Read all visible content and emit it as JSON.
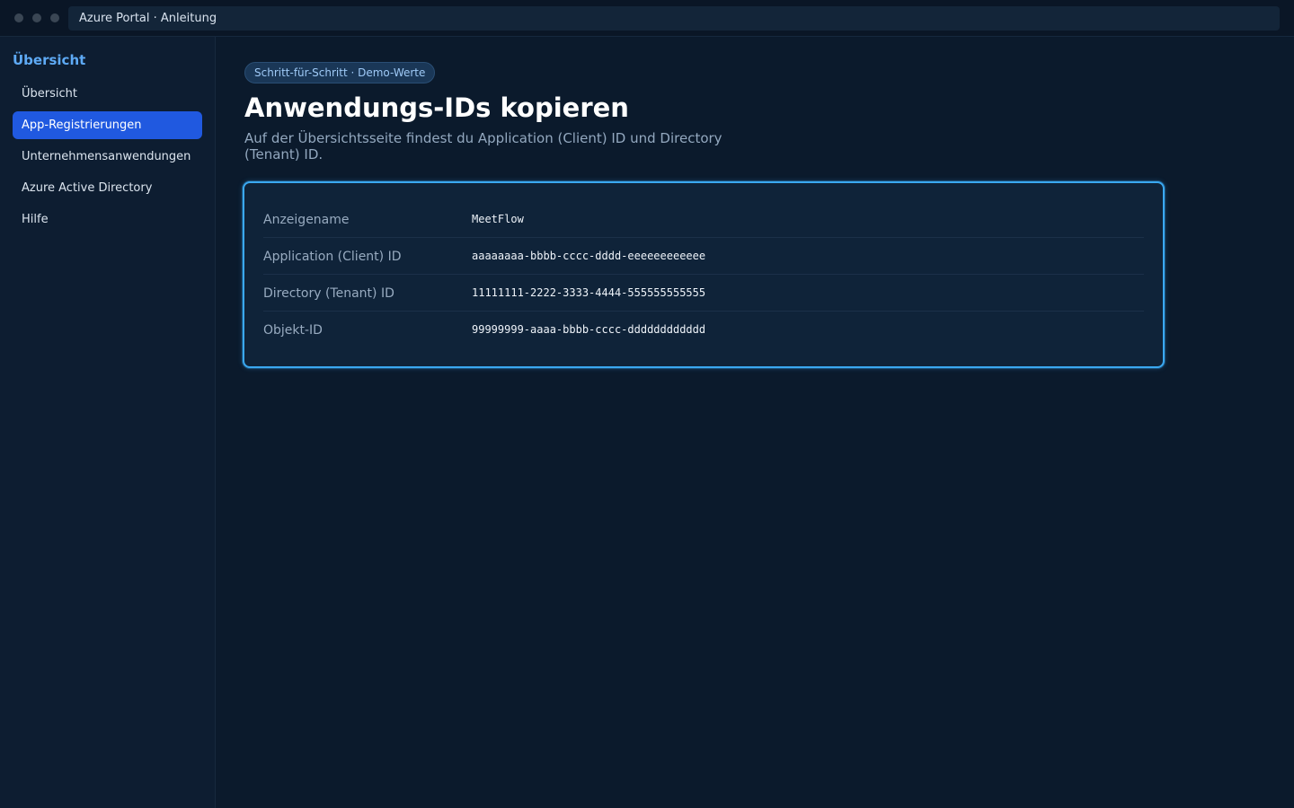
{
  "window": {
    "address": "Azure Portal · Anleitung"
  },
  "sidebar": {
    "title": "Übersicht",
    "items": [
      {
        "label": "Übersicht",
        "active": false
      },
      {
        "label": "App-Registrierungen",
        "active": true
      },
      {
        "label": "Unternehmensanwendungen",
        "active": false
      },
      {
        "label": "Azure Active Directory",
        "active": false
      },
      {
        "label": "Hilfe",
        "active": false
      }
    ]
  },
  "main": {
    "badge": "Schritt-für-Schritt · Demo-Werte",
    "title": "Anwendungs-IDs kopieren",
    "subtitle": "Auf der Übersichtsseite findest du Application (Client) ID und Directory (Tenant) ID.",
    "details": [
      {
        "label": "Anzeigename",
        "value": "MeetFlow"
      },
      {
        "label": "Application (Client) ID",
        "value": "aaaaaaaa-bbbb-cccc-dddd-eeeeeeeeeeee"
      },
      {
        "label": "Directory (Tenant) ID",
        "value": "11111111-2222-3333-4444-555555555555"
      },
      {
        "label": "Objekt-ID",
        "value": "99999999-aaaa-bbbb-cccc-dddddddddddd"
      }
    ]
  },
  "colors": {
    "accent": "#2059e0",
    "highlight_border": "#3aa8f0",
    "sidebar_title": "#5eaaf5"
  }
}
